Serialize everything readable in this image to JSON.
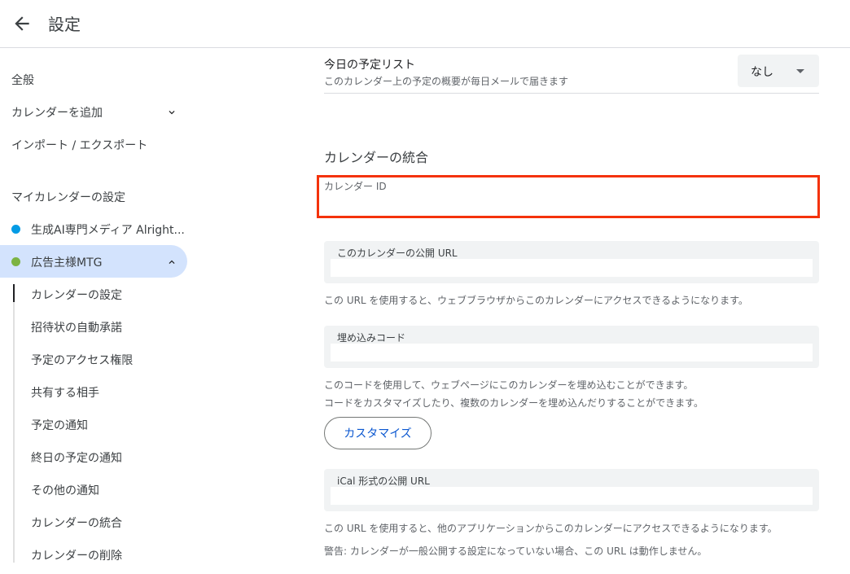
{
  "header": {
    "title": "設定"
  },
  "sidebar": {
    "general": "全般",
    "add_calendar": "カレンダーを追加",
    "import_export": "インポート / エクスポート",
    "my_calendars_heading": "マイカレンダーの設定",
    "calendars": [
      {
        "label": "生成AI専門メディア Alright...",
        "color": "#039be5"
      },
      {
        "label": "広告主様MTG",
        "color": "#7cb342"
      }
    ],
    "sub_items": [
      "カレンダーの設定",
      "招待状の自動承諾",
      "予定のアクセス権限",
      "共有する相手",
      "予定の通知",
      "終日の予定の通知",
      "その他の通知",
      "カレンダーの統合",
      "カレンダーの削除"
    ]
  },
  "main": {
    "agenda_title": "今日の予定リスト",
    "agenda_desc": "このカレンダー上の予定の概要が毎日メールで届きます",
    "agenda_select_value": "なし",
    "integration_title": "カレンダーの統合",
    "calendar_id_label": "カレンダー ID",
    "public_url_label": "このカレンダーの公開 URL",
    "public_url_value": "",
    "public_url_desc": "この URL を使用すると、ウェブブラウザからこのカレンダーにアクセスできるようになります。",
    "embed_label": "埋め込みコード",
    "embed_value": "",
    "embed_desc1": "このコードを使用して、ウェブページにこのカレンダーを埋め込むことができます。",
    "embed_desc2": "コードをカスタマイズしたり、複数のカレンダーを埋め込んだりすることができます。",
    "customize_button": "カスタマイズ",
    "ical_label": "iCal 形式の公開 URL",
    "ical_value": "",
    "ical_desc1": "この URL を使用すると、他のアプリケーションからこのカレンダーにアクセスできるようになります。",
    "ical_desc2": "警告: カレンダーが一般公開する設定になっていない場合、この URL は動作しません。"
  },
  "colors": {
    "highlight": "#f4320b",
    "selected": "#d3e3fd",
    "link": "#0b57d0"
  }
}
